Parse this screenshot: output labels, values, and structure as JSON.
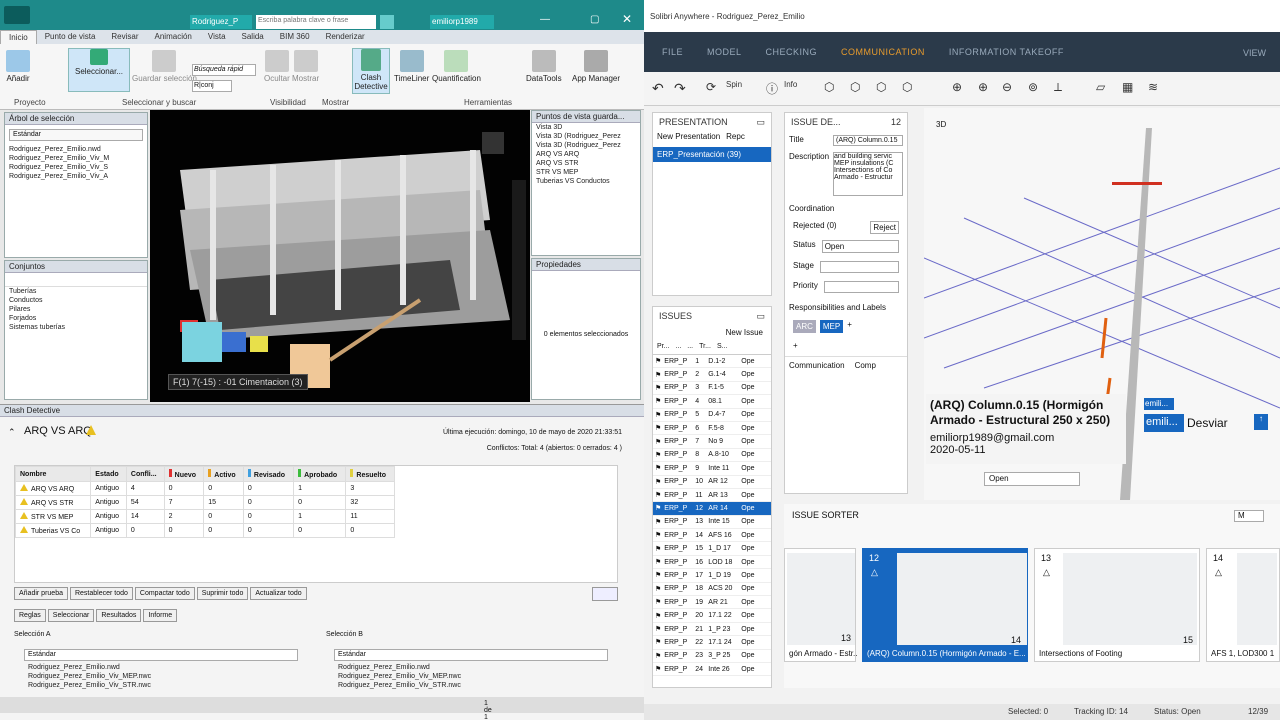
{
  "navis": {
    "title_doc": "Rodriguez_P",
    "search_placeholder": "Escriba palabra clave o frase",
    "user": "emiliorp1989",
    "tabs": [
      "Inicio",
      "Punto de vista",
      "Revisar",
      "Animación",
      "Vista",
      "Salida",
      "BIM 360",
      "Renderizar"
    ],
    "ribbon": {
      "append": "Añadir",
      "select": "Seleccionar...",
      "save_sel": "Guardar selección",
      "quick_search": "Búsqueda rápid",
      "conj": "R|conj",
      "hide": "Ocultar",
      "no_hide": "Mostrar",
      "clash": "Clash Detective",
      "timeliner": "TimeLiner",
      "quantification": "Quantification",
      "datatools": "DataTools",
      "appmanager": "App Manager",
      "groups": [
        "Proyecto",
        "Seleccionar y buscar",
        "Visibilidad",
        "Mostrar",
        "Herramientas"
      ]
    },
    "selection_tree": {
      "title": "Árbol de selección",
      "dropdown": "Estándar",
      "items": [
        "Rodriguez_Perez_Emilio.nwd",
        "Rodriguez_Perez_Emilio_Viv_M",
        "Rodriguez_Perez_Emilio_Viv_S",
        "Rodriguez_Perez_Emilio_Viv_A"
      ]
    },
    "sets": {
      "title": "Conjuntos",
      "items": [
        "Tuberías",
        "Conductos",
        "Pilares",
        "Forjados",
        "Sistemas tuberías"
      ]
    },
    "viewpoints": {
      "title": "Puntos de vista guarda...",
      "items": [
        "Vista 3D",
        "Vista 3D (Rodriguez_Perez",
        "Vista 3D (Rodriguez_Perez",
        "ARQ VS ARQ",
        "ARQ VS STR",
        "STR VS MEP",
        "Tuberias VS Conductos"
      ]
    },
    "properties": {
      "title": "Propiedades",
      "text": "0 elementos seleccionados"
    },
    "viewport_label": "F(1) 7(-15) : -01 Cimentacion (3)",
    "clash": {
      "title": "Clash Detective",
      "test_name": "ARQ VS ARQ",
      "last_run": "Última ejecución:  domingo, 10 de mayo de 2020 21:33:51",
      "conflicts": "Conflictos:  Total:  4  (abiertos:  0  cerrados:  4 )",
      "headers": [
        "Nombre",
        "Estado",
        "Confli...",
        "Nuevo",
        "Activo",
        "Revisado",
        "Aprobado",
        "Resuelto"
      ],
      "status_colors": {
        "nuevo": "#e03030",
        "activo": "#e8a020",
        "revisado": "#40a0e0",
        "aprobado": "#3cbc3c",
        "resuelto": "#e0d040"
      },
      "rows": [
        [
          "ARQ VS ARQ",
          "Antiguo",
          "4",
          "0",
          "0",
          "0",
          "1",
          "3"
        ],
        [
          "ARQ VS STR",
          "Antiguo",
          "54",
          "7",
          "15",
          "0",
          "0",
          "32"
        ],
        [
          "STR VS MEP",
          "Antiguo",
          "14",
          "2",
          "0",
          "0",
          "1",
          "11"
        ],
        [
          "Tuberias VS Co",
          "Antiguo",
          "0",
          "0",
          "0",
          "0",
          "0",
          "0"
        ]
      ],
      "buttons": [
        "Añadir prueba",
        "Restablecer todo",
        "Compactar todo",
        "Suprimir todo",
        "Actualizar todo"
      ],
      "tabs": [
        "Reglas",
        "Seleccionar",
        "Resultados",
        "Informe"
      ],
      "sel_a": {
        "title": "Selección A",
        "dropdown": "Estándar",
        "items": [
          "Rodriguez_Perez_Emilio.nwd",
          "Rodriguez_Perez_Emilio_Viv_MEP.nwc",
          "Rodriguez_Perez_Emilio_Viv_STR.nwc"
        ]
      },
      "sel_b": {
        "title": "Selección B",
        "dropdown": "Estándar",
        "items": [
          "Rodriguez_Perez_Emilio.nwd",
          "Rodriguez_Perez_Emilio_Viv_MEP.nwc",
          "Rodriguez_Perez_Emilio_Viv_STR.nwc"
        ]
      },
      "page": "1 de 1"
    }
  },
  "solibri": {
    "title": "Solibri Anywhere - Rodriguez_Perez_Emilio",
    "menu": [
      "FILE",
      "MODEL",
      "CHECKING",
      "COMMUNICATION",
      "INFORMATION TAKEOFF"
    ],
    "active_menu": "COMMUNICATION",
    "view_label": "VIEW",
    "toolbar": {
      "spin": "Spin",
      "info": "Info"
    },
    "presentation": {
      "title": "PRESENTATION",
      "new": "New Presentation",
      "rep": "Repc",
      "item": "ERP_Presentación (39)"
    },
    "issue_detail": {
      "title": "ISSUE DE...",
      "index": "12",
      "title_label": "Title",
      "title_value": "(ARQ) Column.0.15",
      "desc_label": "Description",
      "desc_lines": [
        "and building servic",
        "MEP insulations (C",
        "Intersections of Co",
        "Armado - Estructur"
      ],
      "coordination": "Coordination",
      "rejected": "Rejected (0)",
      "reject_btn": "Reject",
      "status_label": "Status",
      "status_value": "Open",
      "stage_label": "Stage",
      "priority_label": "Priority",
      "resp_labels": "Responsibilities and Labels",
      "tag_arc": "ARC",
      "tag_mep": "MEP",
      "comm_tab": "Communication",
      "comp_tab": "Comp"
    },
    "issues": {
      "title": "ISSUES",
      "new": "New Issue",
      "headers": [
        "Pr...",
        "...",
        "...",
        "Tr...",
        "S..."
      ],
      "rows": [
        [
          "ERP_P",
          "1",
          "D.1-2",
          "Ope"
        ],
        [
          "ERP_P",
          "2",
          "G.1-4",
          "Ope"
        ],
        [
          "ERP_P",
          "3",
          "F.1-5",
          "Ope"
        ],
        [
          "ERP_P",
          "4",
          "08.1",
          "Ope"
        ],
        [
          "ERP_P",
          "5",
          "D.4-7",
          "Ope"
        ],
        [
          "ERP_P",
          "6",
          "F.5-8",
          "Ope"
        ],
        [
          "ERP_P",
          "7",
          "No 9",
          "Ope"
        ],
        [
          "ERP_P",
          "8",
          "A.8-10",
          "Ope"
        ],
        [
          "ERP_P",
          "9",
          "Inte 11",
          "Ope"
        ],
        [
          "ERP_P",
          "10",
          "AR 12",
          "Ope"
        ],
        [
          "ERP_P",
          "11",
          "AR 13",
          "Ope"
        ],
        [
          "ERP_P",
          "12",
          "AR 14",
          "Ope"
        ],
        [
          "ERP_P",
          "13",
          "Inte 15",
          "Ope"
        ],
        [
          "ERP_P",
          "14",
          "AFS 16",
          "Ope"
        ],
        [
          "ERP_P",
          "15",
          "1_D 17",
          "Ope"
        ],
        [
          "ERP_P",
          "16",
          "LOD 18",
          "Ope"
        ],
        [
          "ERP_P",
          "17",
          "1_D 19",
          "Ope"
        ],
        [
          "ERP_P",
          "18",
          "ACS 20",
          "Ope"
        ],
        [
          "ERP_P",
          "19",
          "AR 21",
          "Ope"
        ],
        [
          "ERP_P",
          "20",
          "17.1 22",
          "Ope"
        ],
        [
          "ERP_P",
          "21",
          "1_P 23",
          "Ope"
        ],
        [
          "ERP_P",
          "22",
          "17.1 24",
          "Ope"
        ],
        [
          "ERP_P",
          "23",
          "3_P 25",
          "Ope"
        ],
        [
          "ERP_P",
          "24",
          "Inte 26",
          "Ope"
        ]
      ],
      "selected_row": 11
    },
    "view3d": "3D",
    "callout": {
      "title": "(ARQ) Column.0.15 (Hormigón Armado - Estructural 250 x 250)",
      "email": "emiliorp1989@gmail.com",
      "date": "2020-05-11",
      "status": "Open"
    },
    "side_user": "emili...",
    "desviar": "Desviar",
    "sorter": {
      "title": "ISSUE SORTER",
      "sort": "M",
      "cards": [
        {
          "num": "",
          "right": "13",
          "cap": "gón Armado - Estr..."
        },
        {
          "num": "12",
          "right": "14",
          "cap": "(ARQ) Column.0.15 (Hormigón Armado - E..."
        },
        {
          "num": "13",
          "right": "15",
          "cap": "Intersections of Footing"
        },
        {
          "num": "14",
          "right": "",
          "cap": "AFS 1, LOD300 1"
        }
      ]
    },
    "status": {
      "selected": "Selected: 0",
      "tracking": "Tracking ID: 14",
      "status": "Status: Open",
      "count": "12/39"
    }
  }
}
